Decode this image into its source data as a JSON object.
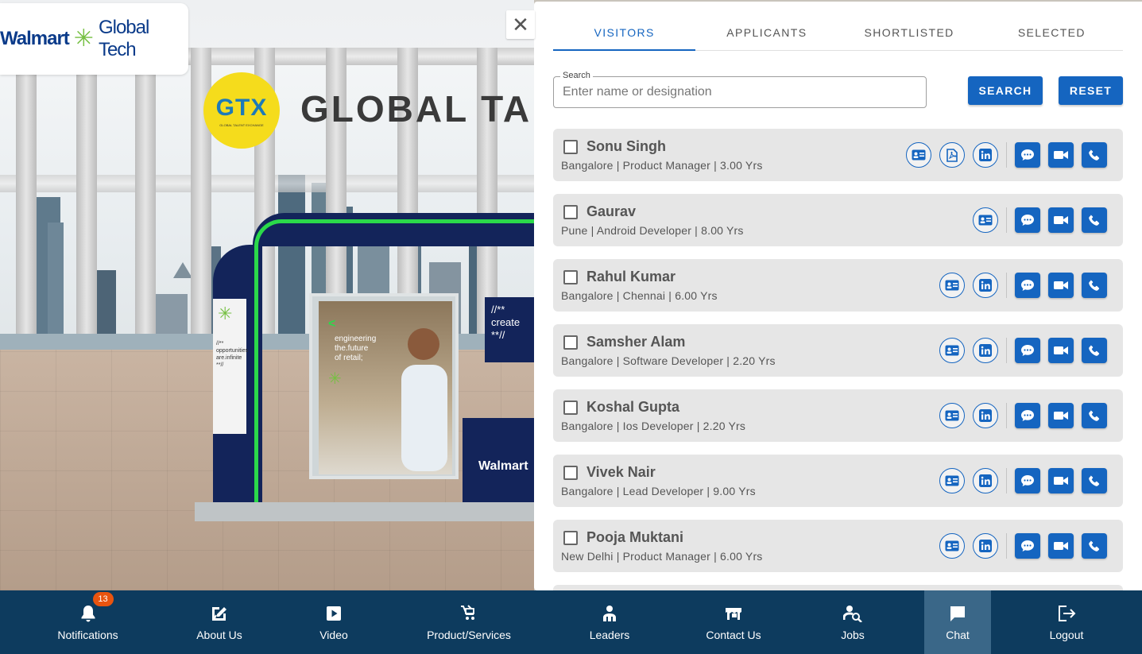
{
  "brand": {
    "logo_left": "Walmart",
    "logo_right": "Global Tech",
    "gtx": "GTX",
    "gtx_sub": "GLOBAL TALENT EXCHANGE",
    "banner": "GLOBAL TAL",
    "leg_text": "//**\nopportunities\nare.infinite\n**//",
    "screen_caption": "engineering\nthe.future\nof retail;",
    "panel_text": "//**\ncreate\n**//",
    "desk_text": "Walmart"
  },
  "close_glyph": "✕",
  "tabs": [
    {
      "label": "VISITORS",
      "active": true
    },
    {
      "label": "APPLICANTS",
      "active": false
    },
    {
      "label": "SHORTLISTED",
      "active": false
    },
    {
      "label": "SELECTED",
      "active": false
    }
  ],
  "search": {
    "label": "Search",
    "placeholder": "Enter name or designation",
    "value": "",
    "search_button": "SEARCH",
    "reset_button": "RESET"
  },
  "colors": {
    "primary": "#1565c0",
    "nav_bg": "#0d3b5e",
    "nav_active": "#3a6788",
    "badge": "#e8540f",
    "booth_green": "#2bd94a",
    "booth_navy": "#13245a"
  },
  "visitors": [
    {
      "name": "Sonu Singh",
      "meta": "Bangalore | Product Manager | 3.00 Yrs",
      "profile_icons": [
        "id-card-icon",
        "pdf-icon",
        "linkedin-icon"
      ]
    },
    {
      "name": "Gaurav",
      "meta": "Pune | Android Developer | 8.00 Yrs",
      "profile_icons": [
        "id-card-icon"
      ]
    },
    {
      "name": "Rahul Kumar",
      "meta": "Bangalore | Chennai | 6.00 Yrs",
      "profile_icons": [
        "id-card-icon",
        "linkedin-icon"
      ]
    },
    {
      "name": "Samsher Alam",
      "meta": "Bangalore | Software Developer | 2.20 Yrs",
      "profile_icons": [
        "id-card-icon",
        "linkedin-icon"
      ]
    },
    {
      "name": "Koshal Gupta",
      "meta": "Bangalore | Ios Developer | 2.20 Yrs",
      "profile_icons": [
        "id-card-icon",
        "linkedin-icon"
      ]
    },
    {
      "name": "Vivek Nair",
      "meta": "Bangalore | Lead Developer | 9.00 Yrs",
      "profile_icons": [
        "id-card-icon",
        "linkedin-icon"
      ]
    },
    {
      "name": "Pooja Muktani",
      "meta": "New Delhi | Product Manager | 6.00 Yrs",
      "profile_icons": [
        "id-card-icon",
        "linkedin-icon"
      ]
    }
  ],
  "contact_actions": [
    "chat-icon",
    "video-call-icon",
    "phone-icon"
  ],
  "bottom_nav": [
    {
      "label": "Notifications",
      "icon": "bell-icon",
      "badge": "13",
      "active": false
    },
    {
      "label": "About Us",
      "icon": "edit-icon",
      "active": false
    },
    {
      "label": "Video",
      "icon": "play-icon",
      "active": false
    },
    {
      "label": "Product/Services",
      "icon": "cart-icon",
      "active": false
    },
    {
      "label": "Leaders",
      "icon": "leaders-icon",
      "active": false
    },
    {
      "label": "Contact Us",
      "icon": "contact-card-icon",
      "active": false
    },
    {
      "label": "Jobs",
      "icon": "job-search-icon",
      "active": false
    },
    {
      "label": "Chat",
      "icon": "chat-bubble-icon",
      "active": true
    },
    {
      "label": "Logout",
      "icon": "logout-icon",
      "active": false
    }
  ]
}
